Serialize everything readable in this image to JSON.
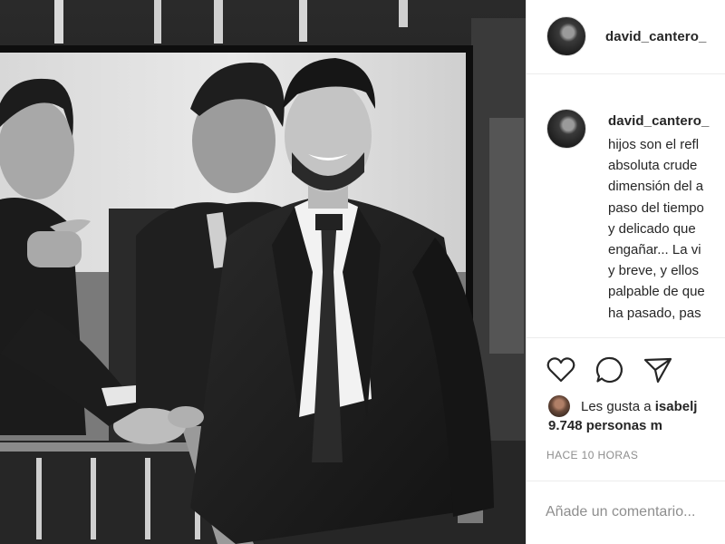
{
  "post": {
    "author": {
      "username": "david_cantero_"
    },
    "image": {
      "description_icon": "photo-black-and-white"
    },
    "caption": {
      "username": "david_cantero_",
      "lines": [
        "hijos son el refl",
        "absoluta crude",
        "dimensión del a",
        "paso del tiempo",
        "y delicado que",
        "engañar... La vi",
        "y breve, y ellos",
        "palpable de que",
        "ha pasado, pas"
      ]
    },
    "actions": {
      "like_icon": "heart-outline-icon",
      "comment_icon": "comment-bubble-icon",
      "share_icon": "paper-plane-icon"
    },
    "likes": {
      "prefix": "Les gusta a ",
      "first_liker": "isabelj",
      "count_text": "9.748 personas m"
    },
    "timestamp": "HACE 10 HORAS",
    "comment": {
      "placeholder": "Añade un comentario...",
      "value": ""
    }
  }
}
